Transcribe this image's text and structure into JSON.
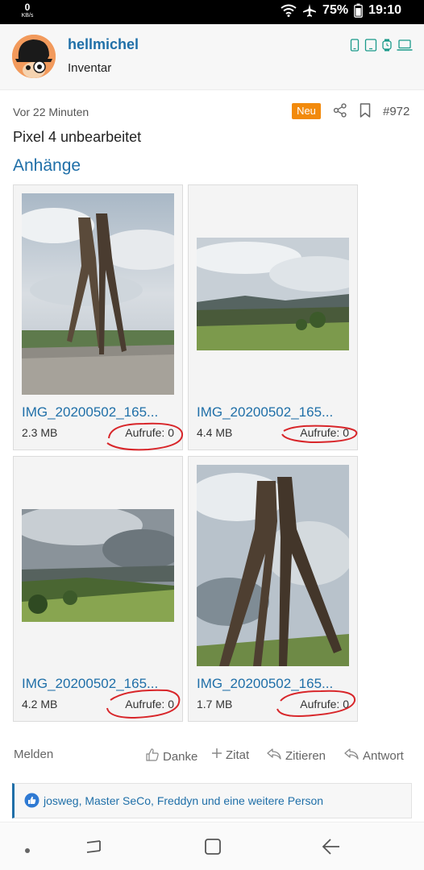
{
  "status_bar": {
    "net_speed": "0",
    "net_unit": "KB/s",
    "battery": "75%",
    "time": "19:10",
    "icons": [
      "wifi-icon",
      "airplane-mode-icon",
      "battery-icon"
    ]
  },
  "author": {
    "name": "hellmichel",
    "role": "Inventar",
    "device_icons": [
      "phone-icon",
      "tablet-icon",
      "watch-icon",
      "laptop-icon"
    ]
  },
  "post": {
    "time": "Vor 22 Minuten",
    "badge": "Neu",
    "number": "#972",
    "text": "Pixel 4 unbearbeitet"
  },
  "attachments": {
    "title": "Anhänge",
    "items": [
      {
        "filename": "IMG_20200502_165...",
        "size": "2.3 MB",
        "views": "Aufrufe: 0"
      },
      {
        "filename": "IMG_20200502_165...",
        "size": "4.4 MB",
        "views": "Aufrufe: 0"
      },
      {
        "filename": "IMG_20200502_165...",
        "size": "4.2 MB",
        "views": "Aufrufe: 0"
      },
      {
        "filename": "IMG_20200502_165...",
        "size": "1.7 MB",
        "views": "Aufrufe: 0"
      }
    ]
  },
  "actions": {
    "report": "Melden",
    "thanks": "Danke",
    "quote": "Zitat",
    "cite": "Zitieren",
    "reply": "Antwort"
  },
  "reactions": {
    "text": "josweg, Master SeCo, Freddyn und eine weitere Person"
  },
  "colors": {
    "link": "#1f6fa8",
    "badge": "#f28a0c",
    "annotation": "#d8262a"
  }
}
